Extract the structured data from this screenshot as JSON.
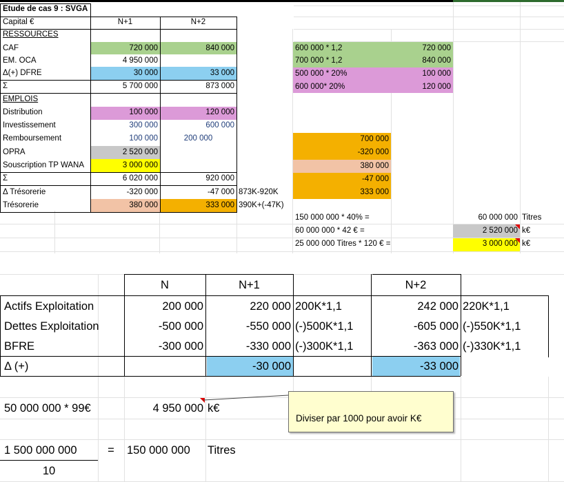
{
  "sheet1": {
    "title": "Etude de cas 9 : SVGA",
    "header": {
      "label": "Capital €",
      "col1": "N+1",
      "col2": "N+2"
    },
    "ressources_label": "RESSOURCES",
    "emplois_label": "EMPLOIS",
    "rows": [
      {
        "label": "CAF",
        "v1": "720 000",
        "v2": "840 000"
      },
      {
        "label": "EM. OCA",
        "v1": "4 950 000",
        "v2": ""
      },
      {
        "label": "Δ(+) DFRE",
        "v1": "30 000",
        "v2": "33 000"
      },
      {
        "label": "Σ",
        "v1": "5 700 000",
        "v2": "873 000"
      },
      {
        "label": "Distribution",
        "v1": "100 000",
        "v2": "120 000"
      },
      {
        "label": "Investissement",
        "v1": "300 000",
        "v2": "600 000"
      },
      {
        "label": "Remboursement",
        "v1": "100 000",
        "v2": "200 000"
      },
      {
        "label": "OPRA",
        "v1": "2 520 000",
        "v2": ""
      },
      {
        "label": "Souscription TP WANA",
        "v1": "3 000 000",
        "v2": ""
      },
      {
        "label": "Σ",
        "v1": "6 020 000",
        "v2": "920 000"
      },
      {
        "label": "Δ Trésorerie",
        "v1": "-320 000",
        "v2": "-47 000"
      },
      {
        "label": "Trésorerie",
        "v1": "380 000",
        "v2": "333 000"
      }
    ],
    "notes": {
      "tres_delta": "873K-920K",
      "tres": "390K+(-47K)"
    },
    "side_calcs": [
      {
        "formula": "600 000 * 1,2",
        "value": "720 000"
      },
      {
        "formula": "700 000 * 1,2",
        "value": "840 000"
      },
      {
        "formula": "500 000 * 20%",
        "value": "100 000"
      },
      {
        "formula": "600 000* 20%",
        "value": "120 000"
      }
    ],
    "tres_stack": [
      "700 000",
      "-320 000",
      "380 000",
      "-47 000",
      "333 000"
    ],
    "titles_calc": [
      {
        "formula": "150 000 000 * 40% =",
        "value": "60 000 000",
        "unit": "Titres"
      },
      {
        "formula": "60 000 000 * 42 € =",
        "value": "2 520 000",
        "unit": "k€"
      },
      {
        "formula": "25 000 000 Titres * 120 € =",
        "value": "3 000 000",
        "unit": "k€"
      }
    ]
  },
  "sheet2": {
    "headers": {
      "n": "N",
      "n1": "N+1",
      "n2": "N+2"
    },
    "rows": [
      {
        "label": "Actifs Exploitation",
        "n": "200 000",
        "n1": "220 000",
        "f1": "200K*1,1",
        "n2": "242 000",
        "f2": "220K*1,1"
      },
      {
        "label": "Dettes Exploitation",
        "n": "-500 000",
        "n1": "-550 000",
        "f1": "(-)500K*1,1",
        "n2": "-605 000",
        "f2": "(-)550K*1,1"
      },
      {
        "label": "BFRE",
        "n": "-300 000",
        "n1": "-330 000",
        "f1": "(-)300K*1,1",
        "n2": "-363 000",
        "f2": "(-)330K*1,1"
      },
      {
        "label": "Δ (+)",
        "n": "",
        "n1": "-30 000",
        "f1": "",
        "n2": "-33 000",
        "f2": ""
      }
    ],
    "oca": {
      "formula": "50 000 000 * 99€",
      "value": "4 950 000",
      "unit": "k€"
    },
    "comment": "Diviser par 1000 pour avoir K€",
    "fraction": {
      "numerator": "1 500 000 000",
      "eq": "=",
      "result": "150 000 000",
      "unit": "Titres",
      "denominator": "10"
    }
  },
  "colors": {
    "green": "#a9d18e",
    "blue": "#8ccff0",
    "pink": "#dc9ad8",
    "grey": "#c8c8c8",
    "yellow": "#ffff00",
    "salmon": "#f2c3a6",
    "orange": "#f4b000"
  }
}
